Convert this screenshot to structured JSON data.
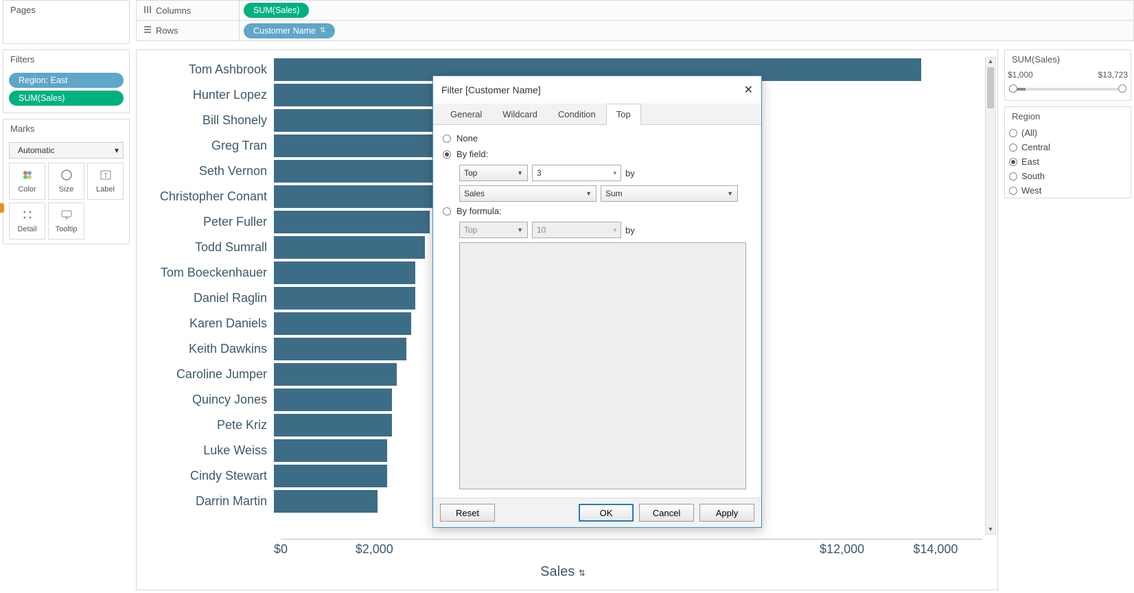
{
  "shelves": {
    "columns_label": "Columns",
    "rows_label": "Rows",
    "columns_pill": "SUM(Sales)",
    "rows_pill": "Customer Name"
  },
  "left": {
    "pages_title": "Pages",
    "filters_title": "Filters",
    "filter_pills": [
      "Region: East",
      "SUM(Sales)"
    ],
    "marks_title": "Marks",
    "marks_type": "Automatic",
    "marks_type_icon": "bar-icon",
    "marks_cells": [
      {
        "name": "color-icon",
        "label": "Color"
      },
      {
        "name": "size-icon",
        "label": "Size"
      },
      {
        "name": "label-icon",
        "label": "Label"
      },
      {
        "name": "detail-icon",
        "label": "Detail"
      },
      {
        "name": "tooltip-icon",
        "label": "Tooltip"
      }
    ]
  },
  "right": {
    "sum_title": "SUM(Sales)",
    "range_min": "$1,000",
    "range_max": "$13,723",
    "region_title": "Region",
    "region_options": [
      {
        "label": "(All)",
        "checked": false
      },
      {
        "label": "Central",
        "checked": false
      },
      {
        "label": "East",
        "checked": true
      },
      {
        "label": "South",
        "checked": false
      },
      {
        "label": "West",
        "checked": false
      }
    ]
  },
  "chart_data": {
    "type": "bar",
    "orientation": "horizontal",
    "xlabel": "Sales",
    "xlim": [
      0,
      15000
    ],
    "ticks": [
      0,
      2000,
      12000,
      14000
    ],
    "tick_labels": [
      "$0",
      "$2,000",
      "$12,000",
      "$14,000"
    ],
    "categories": [
      "Tom Ashbrook",
      "Hunter Lopez",
      "Bill Shonely",
      "Greg Tran",
      "Seth Vernon",
      "Christopher Conant",
      "Peter Fuller",
      "Todd Sumrall",
      "Tom Boeckenhauer",
      "Daniel Raglin",
      "Karen Daniels",
      "Keith Dawkins",
      "Caroline Jumper",
      "Quincy Jones",
      "Pete Kriz",
      "Luke Weiss",
      "Cindy Stewart",
      "Darrin Martin"
    ],
    "values": [
      13700,
      7300,
      6900,
      6700,
      5400,
      3400,
      3300,
      3200,
      3000,
      3000,
      2900,
      2800,
      2600,
      2500,
      2500,
      2400,
      2400,
      2200
    ]
  },
  "dialog": {
    "title": "Filter [Customer Name]",
    "tabs": [
      "General",
      "Wildcard",
      "Condition",
      "Top"
    ],
    "active_tab": "Top",
    "none_label": "None",
    "byfield_label": "By field:",
    "byformula_label": "By formula:",
    "direction": "Top",
    "count": "3",
    "field": "Sales",
    "agg": "Sum",
    "by_text": "by",
    "formula_direction": "Top",
    "formula_count": "10",
    "buttons": {
      "reset": "Reset",
      "ok": "OK",
      "cancel": "Cancel",
      "apply": "Apply"
    }
  }
}
